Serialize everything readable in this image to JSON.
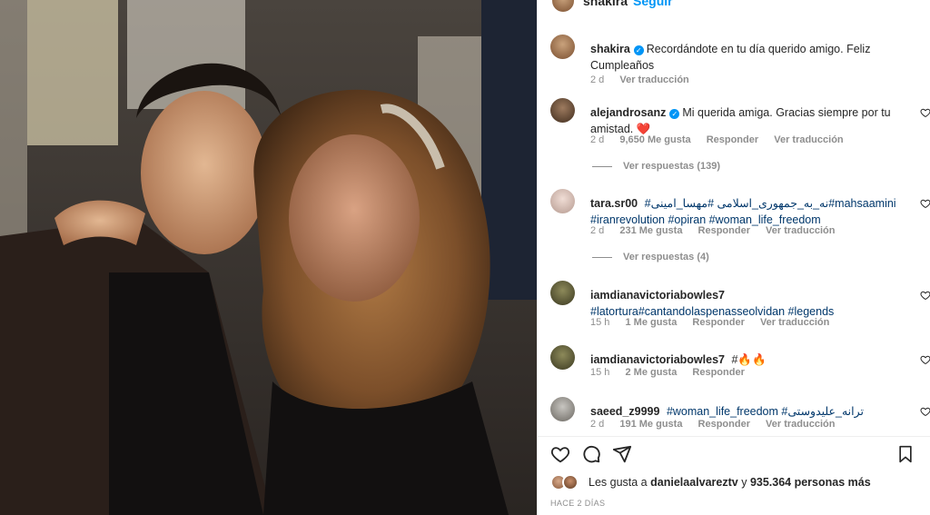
{
  "post": {
    "username": "shakira",
    "follow_label": "Seguir",
    "more_label": "•••"
  },
  "comments": [
    {
      "username": "shakira",
      "verified": true,
      "text": "Recordándote en tu día querido amigo. Feliz Cumpleaños",
      "age": "2 d",
      "likes": "",
      "reply_label": "",
      "translate_label": "Ver traducción"
    },
    {
      "username": "alejandrosanz",
      "verified": true,
      "text": "Mi querida amiga. Gracias siempre por tu amistad. ❤️",
      "age": "2 d",
      "likes": "9,650 Me gusta",
      "reply_label": "Responder",
      "translate_label": "Ver traducción",
      "view_replies": "Ver respuestas (139)"
    },
    {
      "username": "tara.sr00",
      "verified": false,
      "tags": [
        "#نه_به_جمهوری_اسلامی",
        "#مهسا_امینی",
        "#mahsaamini",
        "#iranrevolution",
        "#opiran",
        "#woman_life_freedom"
      ],
      "age": "2 d",
      "likes": "231 Me gusta",
      "reply_label": "Responder",
      "translate_label": "Ver traducción",
      "view_replies": "Ver respuestas (4)"
    },
    {
      "username": "iamdianavictoriabowles7",
      "verified": false,
      "tags": [
        "#latortura",
        "#cantandolaspenasseolvidan",
        "#legends"
      ],
      "age": "15 h",
      "likes": "1 Me gusta",
      "reply_label": "Responder",
      "translate_label": "Ver traducción"
    },
    {
      "username": "iamdianavictoriabowles7",
      "verified": false,
      "text": "#🔥🔥",
      "age": "15 h",
      "likes": "2 Me gusta",
      "reply_label": "Responder",
      "translate_label": ""
    },
    {
      "username": "saeed_z9999",
      "verified": false,
      "tags": [
        "#woman_life_freedom",
        "#ترانه_علیدوستی"
      ],
      "age": "2 d",
      "likes": "191 Me gusta",
      "reply_label": "Responder",
      "translate_label": "Ver traducción"
    }
  ],
  "likes_summary": {
    "prefix": "Les gusta a",
    "user": "danielaalvareztv",
    "middle": "y",
    "count": "935.364 personas más"
  },
  "posted_ago": "HACE 2 DÍAS",
  "colors": {
    "accent": "#0095f6",
    "link": "#00376b",
    "muted": "#8e8e8e",
    "heart": "#ed4956"
  }
}
